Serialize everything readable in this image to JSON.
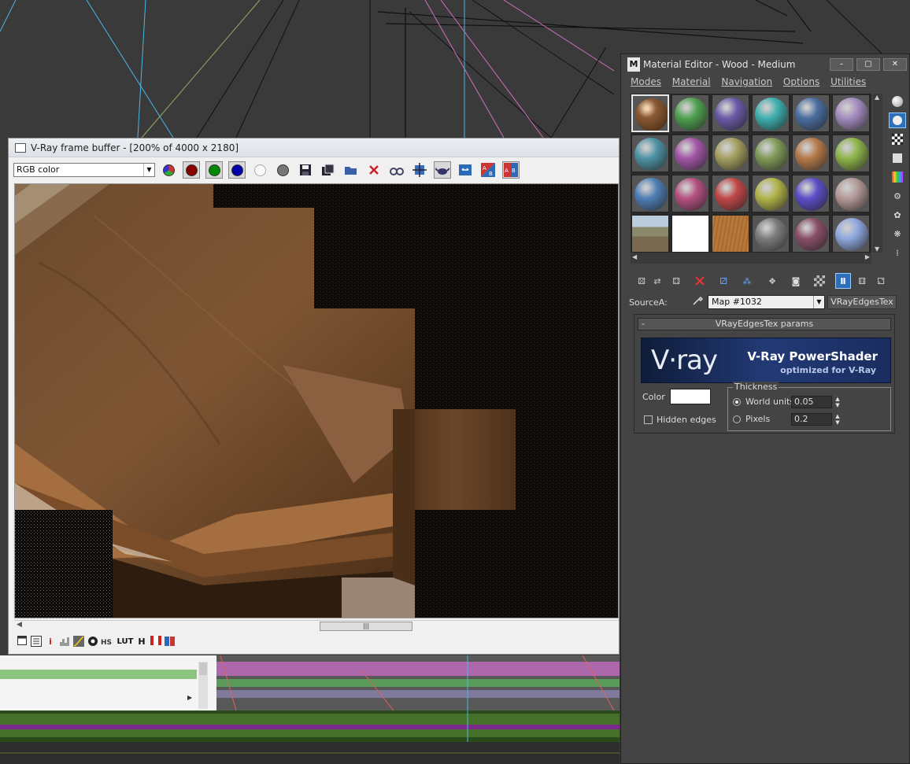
{
  "vfb": {
    "title": "V-Ray frame buffer - [200% of 4000 x 2180]",
    "channel": "RGB color"
  },
  "material_editor": {
    "title": "Material Editor - Wood - Medium",
    "window_buttons": [
      "–",
      "▢",
      "✕"
    ],
    "menu": [
      "Modes",
      "Material",
      "Navigation",
      "Options",
      "Utilities"
    ],
    "source_label": "SourceA:",
    "map_name": "Map #1032",
    "map_type": "VRayEdgesTex",
    "rollout_title": "VRayEdgesTex params",
    "rollout_collapse": "-",
    "banner": {
      "logo": "V·ray",
      "title": "V-Ray PowerShader",
      "subtitle": "optimized for V-Ray"
    },
    "color_label": "Color",
    "hidden_edges_label": "Hidden edges",
    "thickness_label": "Thickness",
    "world_units_label": "World units",
    "world_units_value": "0.05",
    "pixels_label": "Pixels",
    "pixels_value": "0.2",
    "slot_colors": [
      "#8a5a34",
      "#4fa150",
      "#6a5aa8",
      "#3fb0b0",
      "#4a6ea0",
      "#a58cc0",
      "#4f93a5",
      "#a256a6",
      "#a5a060",
      "#7f9b58",
      "#b67a4a",
      "#8fb54a",
      "#4f7fb5",
      "#b55080",
      "#c04848",
      "#b2b44a",
      "#5c4ec8",
      "#b59a98",
      "#7d8a80",
      "#ffffff",
      "#b5793a",
      "#7c7c7c",
      "#8a4f68",
      "#8fa8e0"
    ]
  },
  "bottom_bar_text": {
    "info": "i",
    "lut": "LUT",
    "h": "H"
  }
}
